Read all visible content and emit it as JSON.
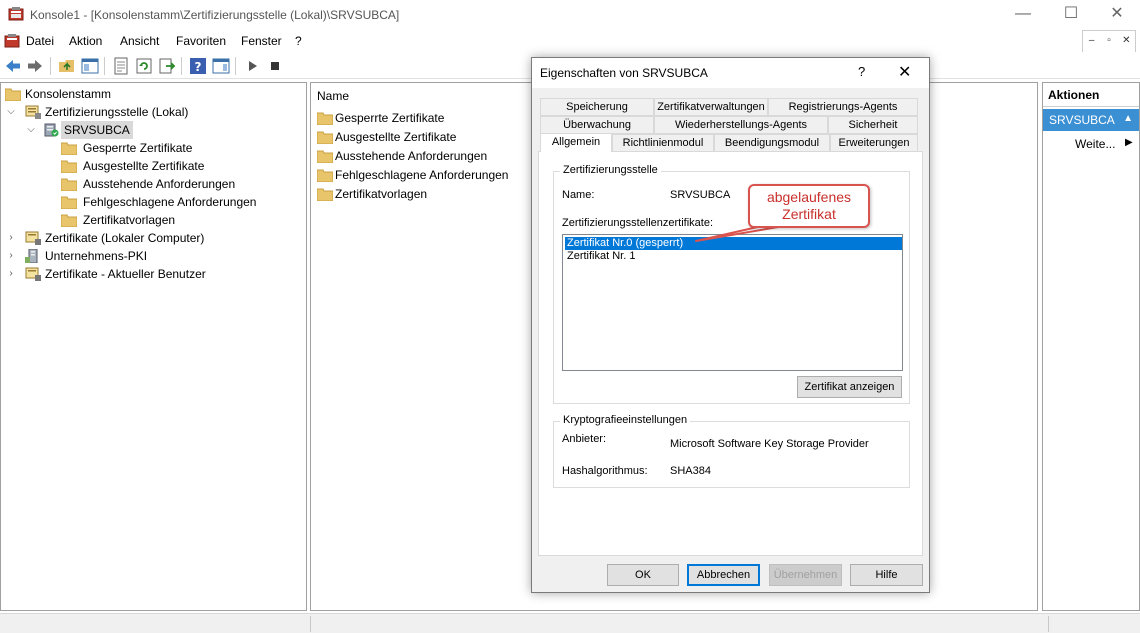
{
  "window": {
    "title": "Konsole1 - [Konsolenstamm\\Zertifizierungsstelle (Lokal)\\SRVSUBCA]",
    "minimize": "—",
    "maximize": "☐",
    "close": "✕"
  },
  "menu": {
    "items": [
      "Datei",
      "Aktion",
      "Ansicht",
      "Favoriten",
      "Fenster",
      "?"
    ],
    "mdi_buttons": [
      "–",
      "▫",
      "✕"
    ]
  },
  "tree": {
    "root": "Konsolenstamm",
    "ca_local": "Zertifizierungsstelle (Lokal)",
    "server": "SRVSUBCA",
    "children": [
      "Gesperrte Zertifikate",
      "Ausgestellte Zertifikate",
      "Ausstehende Anforderungen",
      "Fehlgeschlagene Anforderungen",
      "Zertifikatvorlagen"
    ],
    "others": [
      "Zertifikate (Lokaler Computer)",
      "Unternehmens-PKI",
      "Zertifikate - Aktueller Benutzer"
    ]
  },
  "list": {
    "header": "Name",
    "items": [
      "Gesperrte Zertifikate",
      "Ausgestellte Zertifikate",
      "Ausstehende Anforderungen",
      "Fehlgeschlagene Anforderungen",
      "Zertifikatvorlagen"
    ]
  },
  "actions": {
    "header": "Aktionen",
    "selected": "SRVSUBCA",
    "more": "Weite..."
  },
  "dialog": {
    "title": "Eigenschaften von SRVSUBCA",
    "help": "?",
    "close": "✕",
    "tabs_row1": [
      "Speicherung",
      "Zertifikatverwaltungen",
      "Registrierungs-Agents"
    ],
    "tabs_row2": [
      "Überwachung",
      "Wiederherstellungs-Agents",
      "Sicherheit"
    ],
    "tabs_row3": [
      "Allgemein",
      "Richtlinienmodul",
      "Beendigungsmodul",
      "Erweiterungen"
    ],
    "ca_group": "Zertifizierungsstelle",
    "name_label": "Name:",
    "name_value": "SRVSUBCA",
    "certs_label": "Zertifizierungsstellenzertifikate:",
    "certs": [
      "Zertifikat Nr.0 (gesperrt)",
      "Zertifikat Nr. 1"
    ],
    "view_button": "Zertifikat anzeigen",
    "crypto_group": "Kryptografieeinstellungen",
    "provider_label": "Anbieter:",
    "provider_value": "Microsoft Software Key Storage Provider",
    "hash_label": "Hashalgorithmus:",
    "hash_value": "SHA384",
    "buttons": {
      "ok": "OK",
      "cancel": "Abbrechen",
      "apply": "Übernehmen",
      "help": "Hilfe"
    }
  },
  "callout": {
    "line1": "abgelaufenes",
    "line2": "Zertifikat",
    "color": "#d9534f"
  },
  "colors": {
    "selection": "#0078d7",
    "actions_selected": "#3b8fd3"
  }
}
